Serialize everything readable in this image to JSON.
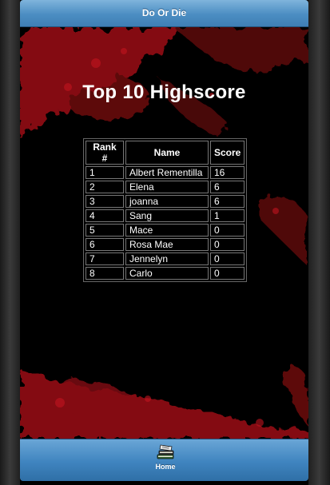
{
  "header": {
    "title": "Do Or Die"
  },
  "main": {
    "title": "Top 10 Highscore",
    "table": {
      "columns": [
        "Rank #",
        "Name",
        "Score"
      ],
      "rows": [
        [
          "1",
          "Albert Rementilla",
          "16"
        ],
        [
          "2",
          "Elena",
          "6"
        ],
        [
          "3",
          "joanna",
          "6"
        ],
        [
          "4",
          "Sang",
          "1"
        ],
        [
          "5",
          "Mace",
          "0"
        ],
        [
          "6",
          "Rosa Mae",
          "0"
        ],
        [
          "7",
          "Jennelyn",
          "0"
        ],
        [
          "8",
          "Carlo",
          "0"
        ]
      ]
    }
  },
  "footer": {
    "home": {
      "label": "Home",
      "icon": "book-stack-icon"
    }
  },
  "colors": {
    "header_bar": "#4b8dc2",
    "background": "#000000",
    "blood": "#b0101a"
  }
}
